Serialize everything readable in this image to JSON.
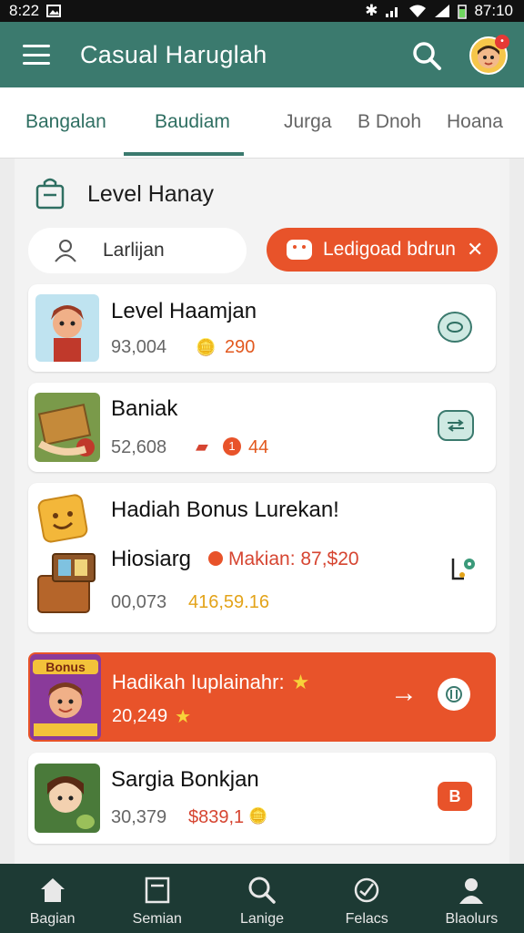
{
  "status": {
    "time": "8:22",
    "clock_right": "87:10"
  },
  "app": {
    "title": "Casual Haruglah"
  },
  "tabs": [
    {
      "label": "Bangalan"
    },
    {
      "label": "Baudiam"
    },
    {
      "label": "Jurga"
    },
    {
      "label": "B Dnoh"
    },
    {
      "label": "Hoana"
    }
  ],
  "section": {
    "title": "Level Hanay"
  },
  "filters": {
    "user_chip": "Larlijan",
    "promo_chip": "Ledigoad bdrun"
  },
  "items": [
    {
      "name": "Level Haamjan",
      "stat": "93,004",
      "points": "290",
      "action_icon": "bubble-icon"
    },
    {
      "name": "Baniak",
      "stat": "52,608",
      "points": "44",
      "action_icon": "exchange-icon"
    },
    {
      "name": "Hadiah Bonus Lurekan!",
      "detail_name": "Hiosiarg",
      "reward": "Makian: 87,$20",
      "stat": "00,073",
      "total": "416,59.16",
      "action_icon": "pin-gear-icon"
    }
  ],
  "promo": {
    "title": "Hadikah Iuplainahr:",
    "value": "20,249",
    "badge_text": "Bonus"
  },
  "last_item": {
    "name": "Sargia Bonkjan",
    "stat": "30,379",
    "reward": "$839,1",
    "action_label": "B"
  },
  "bottom_nav": [
    {
      "label": "Bagian",
      "icon": "home-icon"
    },
    {
      "label": "Semian",
      "icon": "document-icon"
    },
    {
      "label": "Lanige",
      "icon": "search-icon"
    },
    {
      "label": "Felacs",
      "icon": "activity-icon"
    },
    {
      "label": "Blaolurs",
      "icon": "profile-icon"
    }
  ],
  "colors": {
    "primary": "#3b7a6e",
    "accent": "#e8532a",
    "nav_bg": "#1d3a34"
  }
}
